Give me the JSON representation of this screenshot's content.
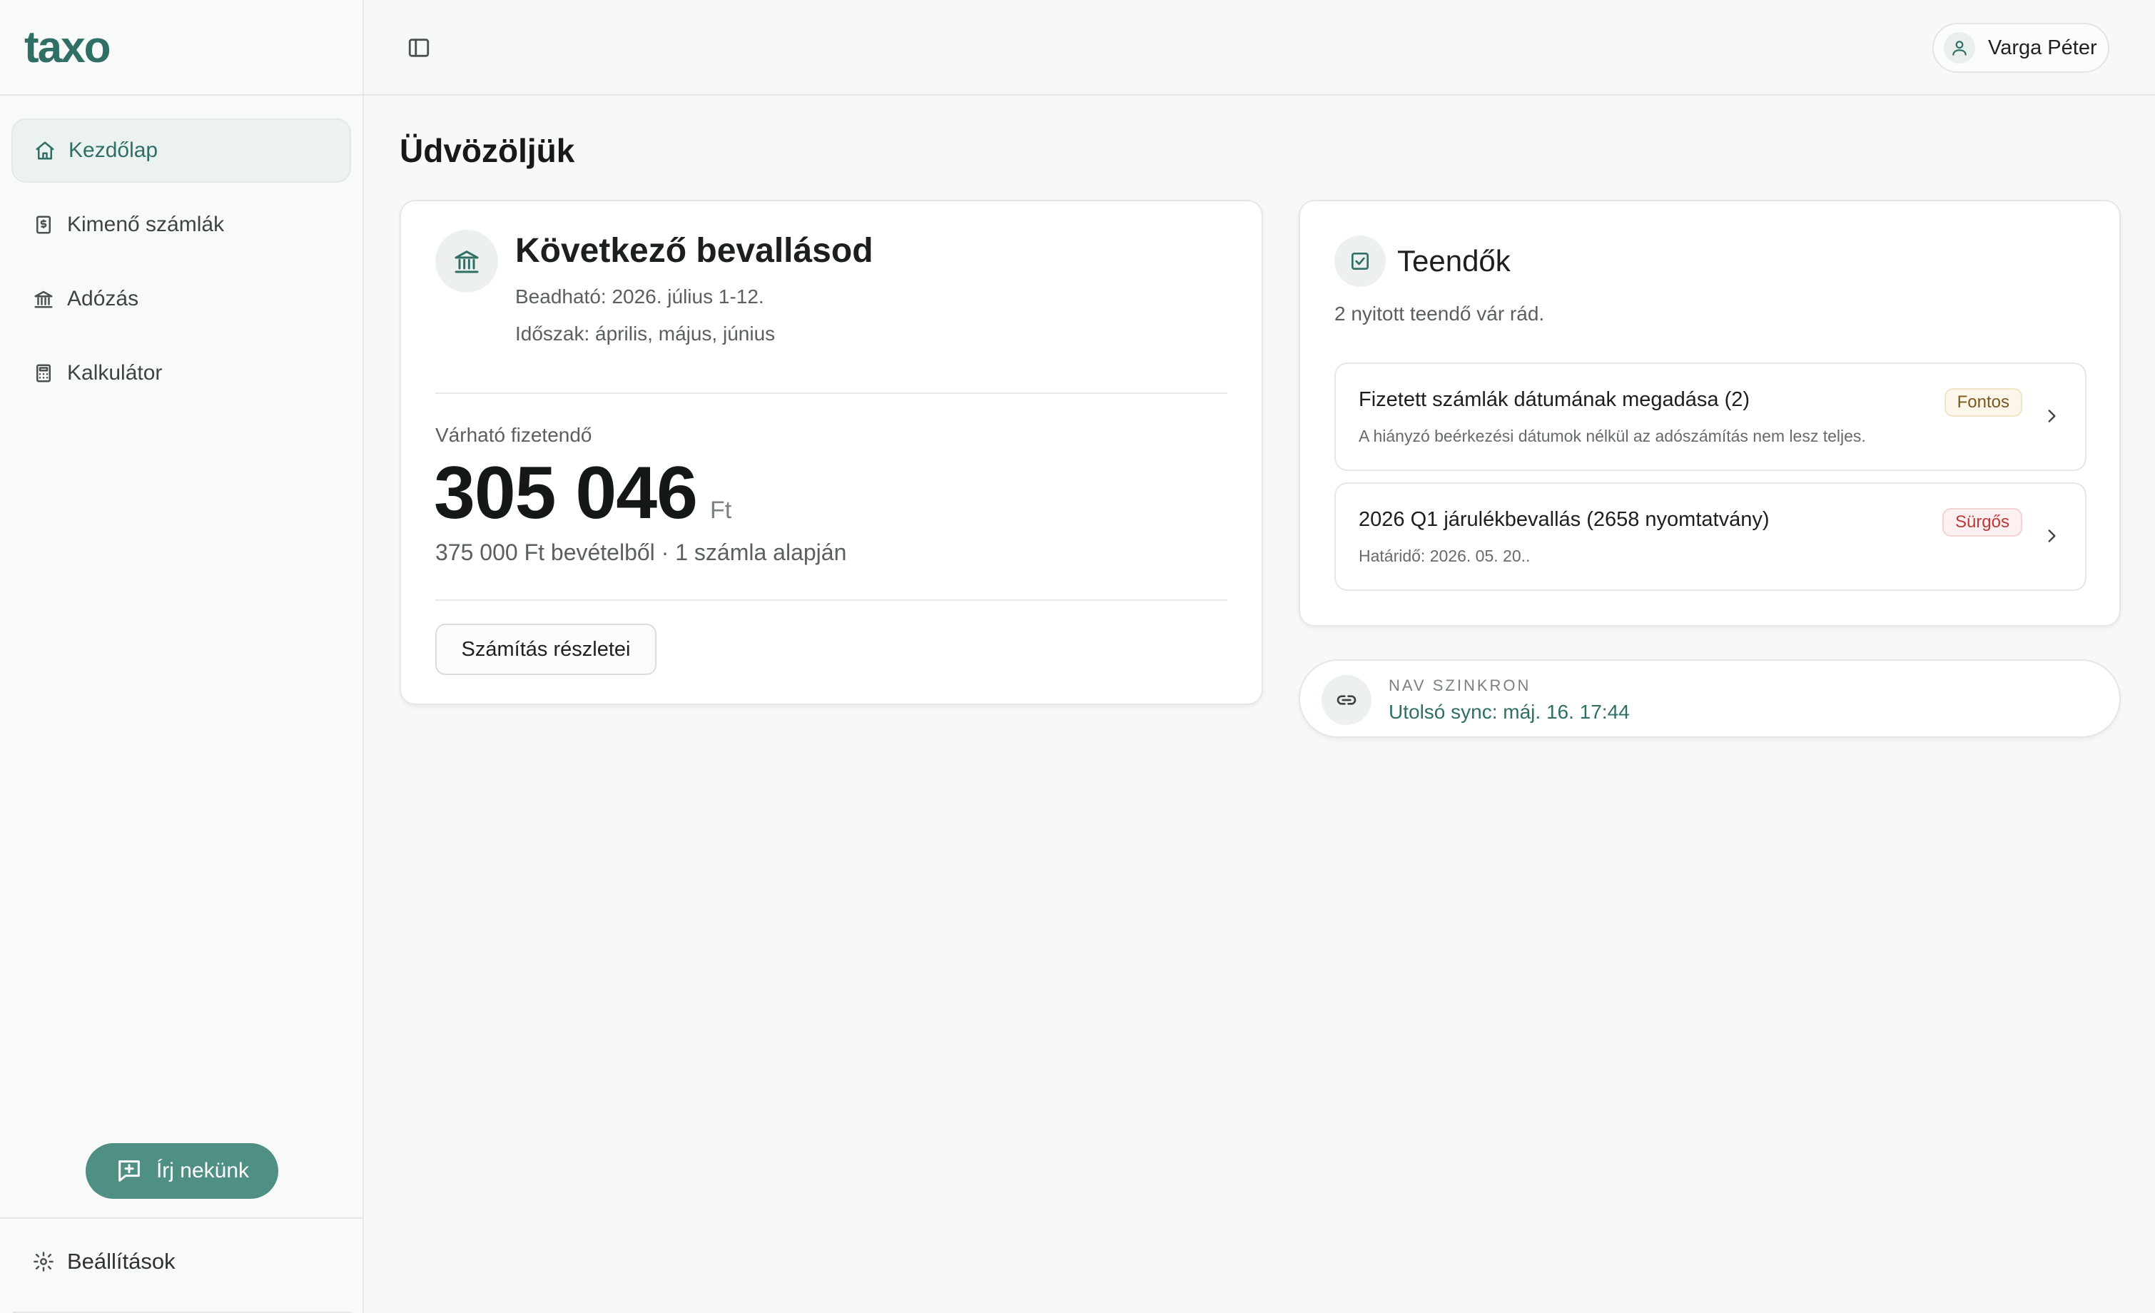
{
  "app": {
    "logo": "taxo"
  },
  "sidebar": {
    "items": [
      {
        "label": "Kezdőlap",
        "icon": "home-icon",
        "active": true
      },
      {
        "label": "Kimenő számlák",
        "icon": "invoice-icon"
      },
      {
        "label": "Adózás",
        "icon": "bank-icon"
      },
      {
        "label": "Kalkulátor",
        "icon": "calculator-icon"
      }
    ],
    "chat_button": "Írj nekünk",
    "settings": "Beállítások"
  },
  "header": {
    "user_name": "Varga Péter"
  },
  "main": {
    "title": "Üdvözöljük",
    "next_filing": {
      "title": "Következő bevallásod",
      "due": "Beadható: 2026. július 1-12.",
      "period": "Időszak: április, május, június",
      "expected_label": "Várható fizetendő",
      "amount": "305 046",
      "currency": "Ft",
      "basis": "375 000 Ft bevételből · 1 számla alapján",
      "details_button": "Számítás részletei"
    },
    "todos": {
      "title": "Teendők",
      "subtitle": "2 nyitott teendő vár rád.",
      "items": [
        {
          "title": "Fizetett számlák dátumának megadása (2)",
          "description": "A hiányzó beérkezési dátumok nélkül az adószámítás nem lesz teljes.",
          "badge": "Fontos"
        },
        {
          "title": "2026 Q1 járulékbevallás (2658 nyomtatvány)",
          "description": "Határidő: 2026. 05. 20..",
          "badge": "Sürgős"
        }
      ]
    },
    "sync": {
      "label": "NAV SZINKRON",
      "value": "Utolsó sync: máj. 16. 17:44"
    }
  },
  "colors": {
    "brand": "#2f6f65",
    "chat_button": "#4f8f84",
    "badge_important": "#7a5a1c",
    "badge_urgent": "#b93a3a"
  }
}
